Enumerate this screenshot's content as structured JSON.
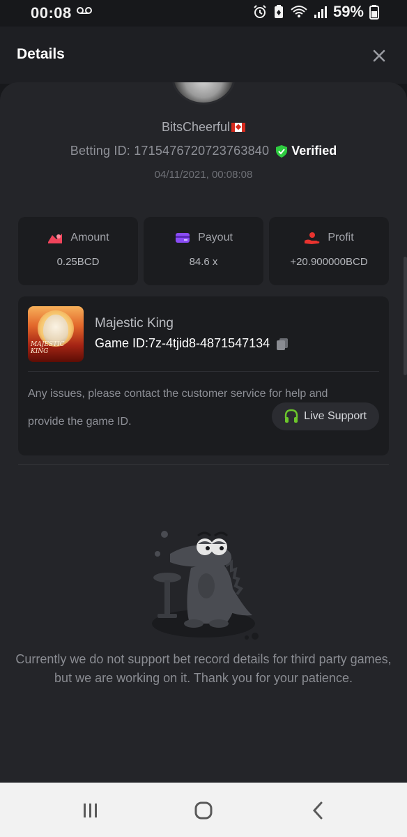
{
  "status_bar": {
    "time": "00:08",
    "battery_text": "59%",
    "icons": [
      "voicemail-icon",
      "alarm-icon",
      "battery-saver-icon",
      "wifi-icon",
      "signal-icon",
      "battery-icon"
    ]
  },
  "header": {
    "title": "Details",
    "close_icon": "close-icon"
  },
  "profile": {
    "username": "BitsCheerful",
    "flag": "canada-flag-icon",
    "betting_id": "Betting ID: 1715476720723763840",
    "verified_label": "Verified",
    "datetime": "04/11/2021, 00:08:08"
  },
  "stats": [
    {
      "label": "Amount",
      "value": "0.25BCD",
      "icon": "amount-icon",
      "color": "#f0445b"
    },
    {
      "label": "Payout",
      "value": "84.6 x",
      "icon": "payout-card-icon",
      "color": "#8a4cf5"
    },
    {
      "label": "Profit",
      "value": "+20.900000BCD",
      "icon": "profit-hand-icon",
      "color": "#e8332f"
    }
  ],
  "game": {
    "name": "Majestic King",
    "game_id": "Game ID:7z-4tjid8-4871547134",
    "thumb_text": "MAJESTIC KING",
    "issues_line1": "Any issues, please contact the customer service for help and",
    "issues_line2": "provide the game ID.",
    "live_support_label": "Live Support"
  },
  "notice": "Currently we do not support bet record details for third party games, but we are working on it. Thank you for your patience.",
  "colors": {
    "background": "#17181b",
    "sheet": "#242529",
    "card": "#1b1c1f",
    "verified_green": "#2ecc40",
    "support_green": "#6cc72b"
  }
}
